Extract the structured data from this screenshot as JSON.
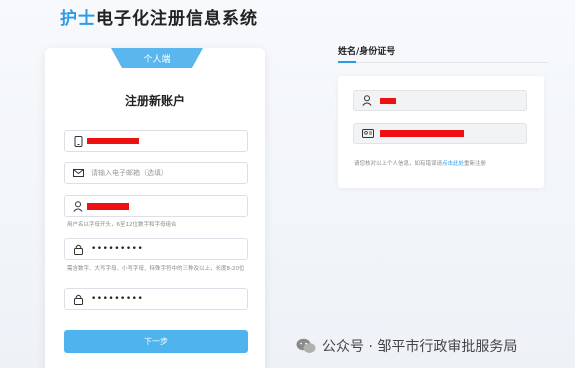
{
  "header": {
    "title_accent": "护士",
    "title_rest": "电子化注册信息系统"
  },
  "register_card": {
    "tab_label": "个人端",
    "heading": "注册新账户",
    "phone_field": {
      "icon": "phone-icon",
      "value_redacted": true
    },
    "email_field": {
      "icon": "mail-icon",
      "placeholder": "请输入电子邮箱（选填）"
    },
    "username_field": {
      "icon": "user-icon",
      "value_redacted": true,
      "hint": "用户名以字母开头，6至12位数字和字母组合"
    },
    "password_field": {
      "icon": "lock-icon",
      "value": "•••••••••",
      "hint": "需含数字、大写字母、小写字母、特殊字符中的三种及以上，长度8-20位"
    },
    "confirm_password_field": {
      "icon": "lock-icon",
      "value": "•••••••••"
    },
    "next_button": "下一步"
  },
  "identity_panel": {
    "heading": "姓名/身份证号",
    "name_field": {
      "icon": "user-icon",
      "value_redacted": true
    },
    "id_field": {
      "icon": "id-card-icon",
      "value_redacted": true
    },
    "note_prefix": "请您核对以上个人信息，如有错误请",
    "note_link": "点击此处",
    "note_suffix": "重新注册"
  },
  "watermark": {
    "text": "公众号 · 邹平市行政审批服务局"
  },
  "colors": {
    "accent": "#2b9be8",
    "button": "#4fb3ee",
    "redaction": "#ee1111"
  }
}
